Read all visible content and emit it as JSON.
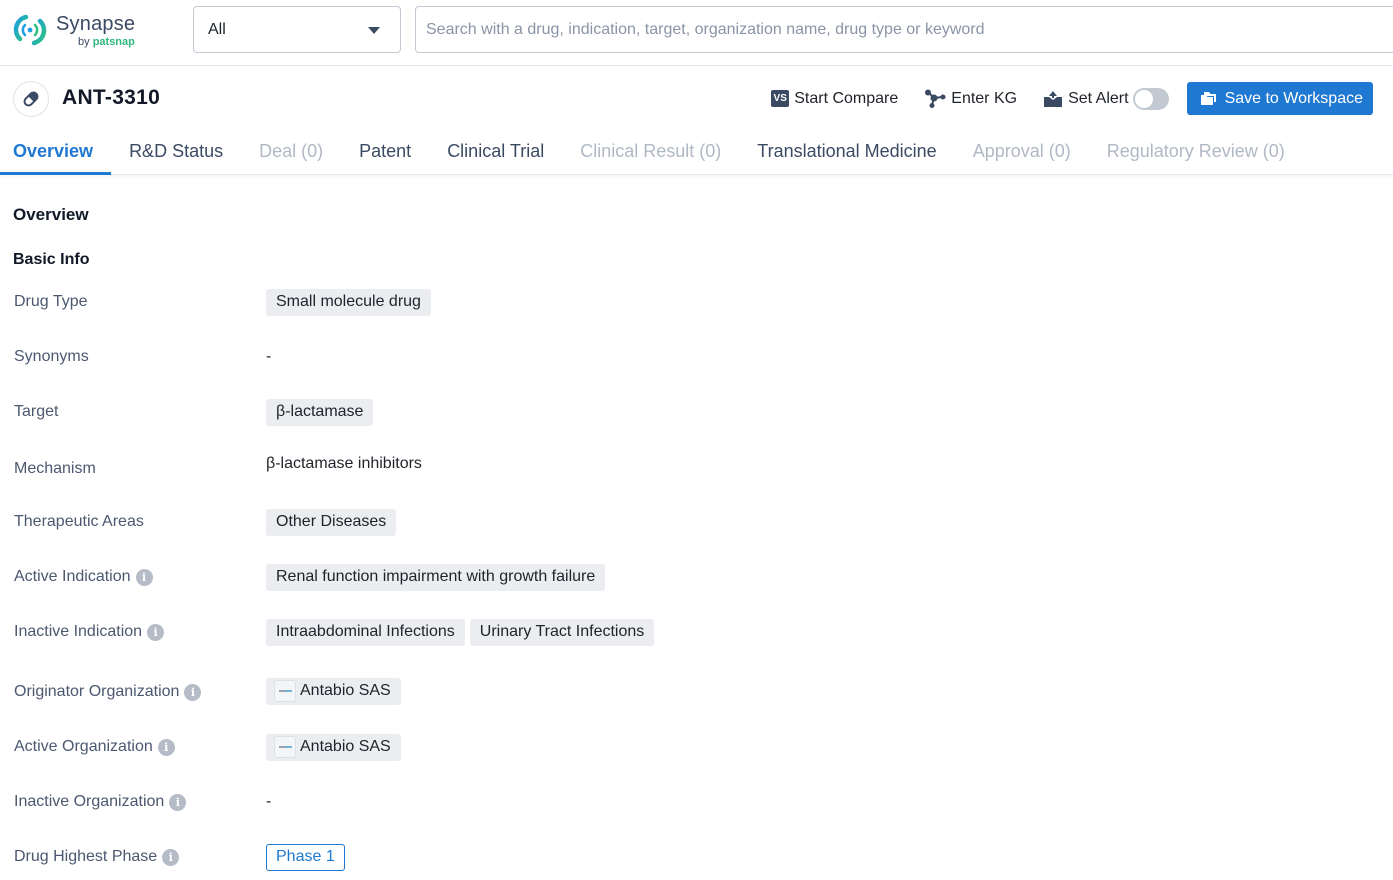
{
  "brand": {
    "name": "Synapse",
    "by": "by",
    "company": "patsnap"
  },
  "search": {
    "scope_value": "All",
    "placeholder": "Search with a drug, indication, target, organization name, drug type or keyword",
    "value": ""
  },
  "drug": {
    "icon": "pill-icon",
    "title": "ANT-3310"
  },
  "actions": {
    "compare_badge": "VS",
    "compare_label": "Start Compare",
    "kg_label": "Enter KG",
    "alert_label": "Set Alert",
    "alert_enabled": false,
    "save_label": "Save to Workspace"
  },
  "colors": {
    "accent": "#1f78d1",
    "text": "#1f2329",
    "muted": "#4b5870",
    "disabled": "#b1b8c5",
    "chip_bg": "#ecedf1"
  },
  "tabs": [
    {
      "label": "Overview",
      "state": "active"
    },
    {
      "label": "R&D Status",
      "state": "enabled"
    },
    {
      "label": "Deal (0)",
      "state": "disabled"
    },
    {
      "label": "Patent",
      "state": "enabled"
    },
    {
      "label": "Clinical Trial",
      "state": "enabled"
    },
    {
      "label": "Clinical Result (0)",
      "state": "disabled"
    },
    {
      "label": "Translational Medicine",
      "state": "enabled"
    },
    {
      "label": "Approval (0)",
      "state": "disabled"
    },
    {
      "label": "Regulatory Review (0)",
      "state": "disabled"
    }
  ],
  "overview": {
    "section_title": "Overview",
    "subsection_title": "Basic Info",
    "fields": {
      "drug_type": {
        "label": "Drug Type",
        "values": [
          "Small molecule drug"
        ]
      },
      "synonyms": {
        "label": "Synonyms",
        "value": "-"
      },
      "target": {
        "label": "Target",
        "values": [
          "β-lactamase"
        ]
      },
      "mechanism": {
        "label": "Mechanism",
        "value": "β-lactamase inhibitors"
      },
      "therapeutic_areas": {
        "label": "Therapeutic Areas",
        "values": [
          "Other Diseases"
        ]
      },
      "active_indication": {
        "label": "Active Indication",
        "values": [
          "Renal function impairment with growth failure"
        ]
      },
      "inactive_indication": {
        "label": "Inactive Indication",
        "values": [
          "Intraabdominal Infections",
          "Urinary Tract Infections"
        ]
      },
      "originator_organization": {
        "label": "Originator Organization",
        "values": [
          "Antabio SAS"
        ]
      },
      "active_organization": {
        "label": "Active Organization",
        "values": [
          "Antabio SAS"
        ]
      },
      "inactive_organization": {
        "label": "Inactive Organization",
        "value": "-"
      },
      "drug_highest_phase": {
        "label": "Drug Highest Phase",
        "value": "Phase 1"
      }
    }
  }
}
